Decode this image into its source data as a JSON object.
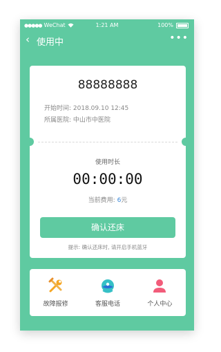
{
  "statusbar": {
    "carrier": "WeChat",
    "time": "1:21 AM",
    "battery": "100%"
  },
  "navbar": {
    "title": "使用中",
    "back_icon": "chevron-left-icon",
    "more_icon": "more-icon"
  },
  "card": {
    "code": "88888888",
    "start_label": "开始时间:",
    "start_value": "2018.09.10   12:45",
    "hospital_label": "所属医院:",
    "hospital_value": "中山市中医院",
    "duration_label": "使用时长",
    "timer": "00:00:00",
    "fee_label": "当前费用:",
    "fee_value": "6",
    "fee_unit": "元",
    "confirm_button": "确认还床",
    "tip": "提示: 确认还床时, 请开启手机蓝牙"
  },
  "bottom": {
    "items": [
      {
        "label": "故障报修",
        "icon": "repair-tools-icon"
      },
      {
        "label": "客服电话",
        "icon": "customer-service-icon"
      },
      {
        "label": "个人中心",
        "icon": "user-icon"
      }
    ]
  },
  "colors": {
    "primary": "#5fcaa1",
    "fee_value": "#3b88d8"
  }
}
